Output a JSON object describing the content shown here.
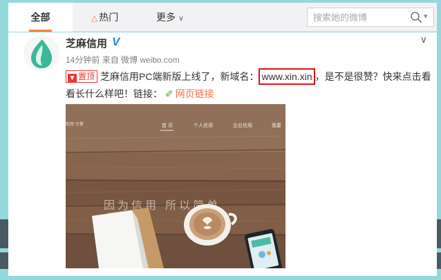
{
  "tabs": [
    {
      "label": "全部"
    },
    {
      "label": "热门"
    },
    {
      "label": "更多"
    }
  ],
  "search": {
    "placeholder": "搜索她的微博"
  },
  "post": {
    "username": "芝麻信用",
    "verified_badge": "V",
    "time": "14分钟前",
    "source": "来自 微博 weibo.com",
    "pin_label": "置顶",
    "text_before": "芝麻信用PC端新版上线了，新域名：",
    "domain": "www.xin.xin",
    "text_after": "，是不是很赞？快来点击看看长什么样吧！链接：",
    "link_label": "网页链接"
  },
  "image": {
    "nav_items": [
      "首 页",
      "个人信用",
      "企业信用",
      "我要"
    ],
    "side_text": "信用\n引擎",
    "slogan": "因为信用  所以简单"
  },
  "colors": {
    "accent": "#fa7d3c",
    "verified": "#1a8ded",
    "pin": "#e33333",
    "highlight_box": "#e01010",
    "link": "#eb7350"
  }
}
